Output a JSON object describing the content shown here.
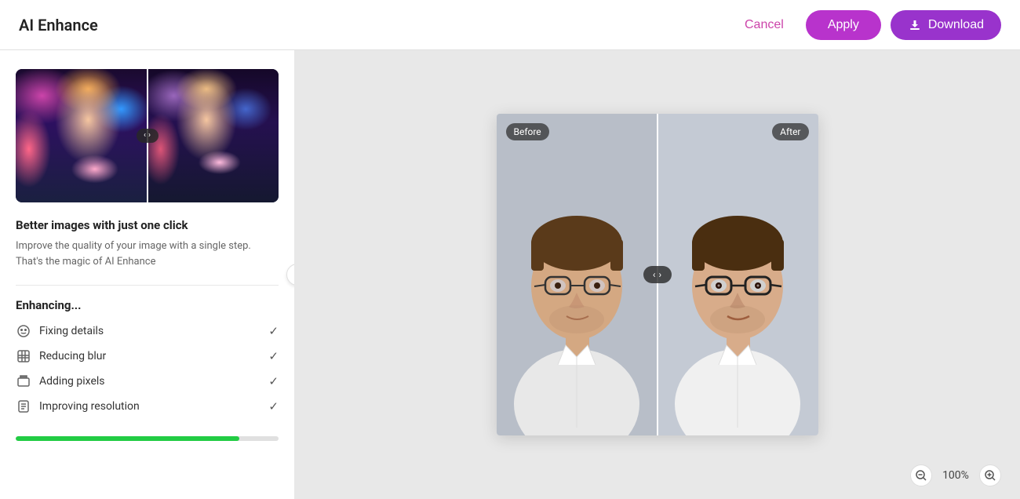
{
  "header": {
    "title": "AI Enhance",
    "cancel_label": "Cancel",
    "apply_label": "Apply",
    "download_label": "Download"
  },
  "left_panel": {
    "description_title": "Better images with just one click",
    "description_text": "Improve the quality of your image with a single step. That's the magic of AI Enhance",
    "enhancing_title": "Enhancing...",
    "enhancing_items": [
      {
        "label": "Fixing details",
        "checked": true,
        "icon": "smile-icon"
      },
      {
        "label": "Reducing blur",
        "checked": true,
        "icon": "grid-icon"
      },
      {
        "label": "Adding pixels",
        "checked": true,
        "icon": "expand-icon"
      },
      {
        "label": "Improving resolution",
        "checked": true,
        "icon": "document-icon"
      }
    ],
    "progress_percent": 85
  },
  "comparison": {
    "before_label": "Before",
    "after_label": "After"
  },
  "zoom": {
    "level": "100%",
    "zoom_in_label": "+",
    "zoom_out_label": "−"
  }
}
